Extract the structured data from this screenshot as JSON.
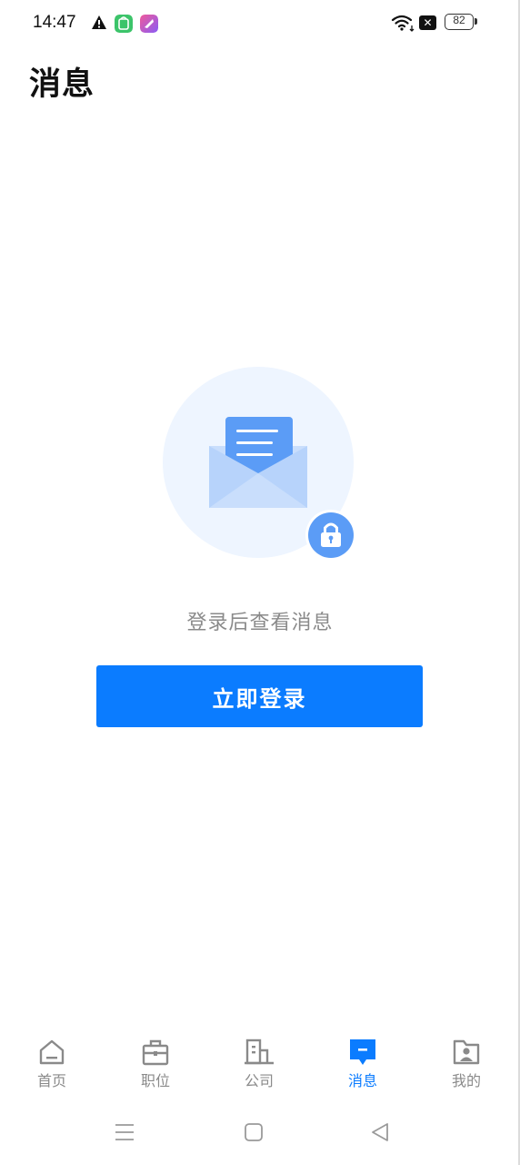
{
  "status_bar": {
    "time": "14:47",
    "battery": "82",
    "icons": [
      "warning-icon",
      "app-notification-icon",
      "app-notification-icon",
      "wifi-icon",
      "sim-x-icon",
      "battery-icon"
    ]
  },
  "header": {
    "title": "消息"
  },
  "empty_state": {
    "illustration": "locked-envelope-icon",
    "hint": "登录后查看消息",
    "login_button": "立即登录"
  },
  "tab_bar": {
    "active": "消息",
    "items": [
      {
        "label": "首页",
        "icon": "home-icon"
      },
      {
        "label": "职位",
        "icon": "briefcase-icon"
      },
      {
        "label": "公司",
        "icon": "building-icon"
      },
      {
        "label": "消息",
        "icon": "message-icon"
      },
      {
        "label": "我的",
        "icon": "profile-folder-icon"
      }
    ]
  },
  "system_nav": [
    "menu-icon",
    "home-square-icon",
    "back-triangle-icon"
  ],
  "colors": {
    "accent": "#0b7cff",
    "muted_text": "#8a8a8a",
    "illustration_bg": "#eef5ff"
  }
}
